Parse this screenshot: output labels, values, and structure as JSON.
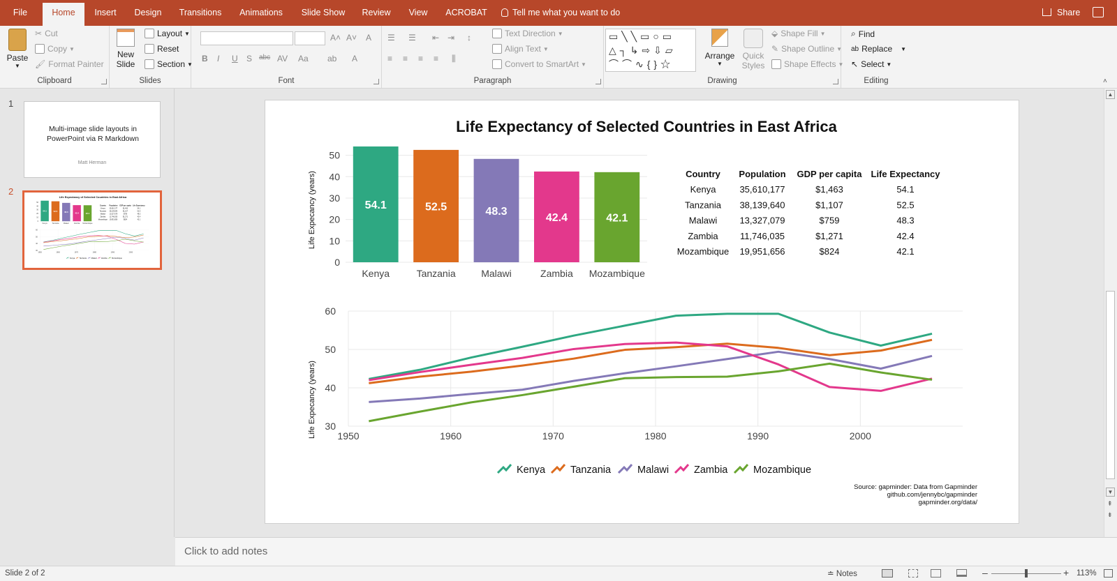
{
  "tabs": [
    {
      "label": "File"
    },
    {
      "label": "Home"
    },
    {
      "label": "Insert"
    },
    {
      "label": "Design"
    },
    {
      "label": "Transitions"
    },
    {
      "label": "Animations"
    },
    {
      "label": "Slide Show"
    },
    {
      "label": "Review"
    },
    {
      "label": "View"
    },
    {
      "label": "ACROBAT"
    }
  ],
  "tell_me": "Tell me what you want to do",
  "share": "Share",
  "ribbon": {
    "clipboard": {
      "label": "Clipboard",
      "paste": "Paste",
      "cut": "Cut",
      "copy": "Copy",
      "format_painter": "Format Painter"
    },
    "slides": {
      "label": "Slides",
      "new_slide_1": "New",
      "new_slide_2": "Slide",
      "layout": "Layout",
      "reset": "Reset",
      "section": "Section"
    },
    "font": {
      "label": "Font"
    },
    "paragraph": {
      "label": "Paragraph",
      "text_direction": "Text Direction",
      "align_text": "Align Text",
      "convert": "Convert to SmartArt"
    },
    "drawing": {
      "label": "Drawing",
      "arrange": "Arrange",
      "quick_styles_1": "Quick",
      "quick_styles_2": "Styles",
      "shape_fill": "Shape Fill",
      "shape_outline": "Shape Outline",
      "shape_effects": "Shape Effects"
    },
    "editing": {
      "label": "Editing",
      "find": "Find",
      "replace": "Replace",
      "select": "Select"
    }
  },
  "thumbnails": [
    {
      "num": "1",
      "title": "Multi-image slide layouts in PowerPoint via R Markdown",
      "author": "Matt Herman"
    },
    {
      "num": "2"
    }
  ],
  "notes_placeholder": "Click to add notes",
  "status": {
    "slide": "Slide 2 of 2",
    "notes": "Notes",
    "zoom": "113%"
  },
  "chart_data": [
    {
      "type": "bar",
      "title": "Life Expectancy of Selected Countries in East Africa",
      "ylabel": "Life Expecancy (years)",
      "categories": [
        "Kenya",
        "Tanzania",
        "Malawi",
        "Zambia",
        "Mozambique"
      ],
      "values": [
        54.1,
        52.5,
        48.3,
        42.4,
        42.1
      ],
      "data_labels": [
        "54.1",
        "52.5",
        "48.3",
        "42.4",
        "42.1"
      ],
      "colors": [
        "#2ea882",
        "#dc6b1d",
        "#8479b7",
        "#e3388c",
        "#69a52f"
      ],
      "ylim": [
        0,
        54.1
      ],
      "yticks": [
        "0",
        "10",
        "20",
        "30",
        "40",
        "50"
      ]
    },
    {
      "type": "table",
      "columns": [
        "Country",
        "Population",
        "GDP per capita",
        "Life Expectancy"
      ],
      "rows": [
        [
          "Kenya",
          "35,610,177",
          "$1,463",
          "54.1"
        ],
        [
          "Tanzania",
          "38,139,640",
          "$1,107",
          "52.5"
        ],
        [
          "Malawi",
          "13,327,079",
          "$759",
          "48.3"
        ],
        [
          "Zambia",
          "11,746,035",
          "$1,271",
          "42.4"
        ],
        [
          "Mozambique",
          "19,951,656",
          "$824",
          "42.1"
        ]
      ]
    },
    {
      "type": "line",
      "ylabel": "Life Expecancy (years)",
      "x": [
        1952,
        1957,
        1962,
        1967,
        1972,
        1977,
        1982,
        1987,
        1992,
        1997,
        2002,
        2007
      ],
      "xlim": [
        1950,
        2010
      ],
      "ylim": [
        30,
        60
      ],
      "xticks": [
        "1950",
        "1960",
        "1970",
        "1980",
        "1990",
        "2000"
      ],
      "yticks": [
        "30",
        "40",
        "50",
        "60"
      ],
      "series": [
        {
          "name": "Kenya",
          "color": "#2ea882",
          "values": [
            42.3,
            44.7,
            47.9,
            50.7,
            53.6,
            56.2,
            58.8,
            59.3,
            59.3,
            54.4,
            51.0,
            54.1
          ]
        },
        {
          "name": "Tanzania",
          "color": "#dc6b1d",
          "values": [
            41.2,
            42.9,
            44.2,
            45.8,
            47.6,
            49.9,
            50.6,
            51.5,
            50.4,
            48.5,
            49.7,
            52.5
          ]
        },
        {
          "name": "Malawi",
          "color": "#8479b7",
          "values": [
            36.3,
            37.2,
            38.4,
            39.5,
            41.8,
            43.8,
            45.6,
            47.5,
            49.4,
            47.5,
            45.0,
            48.3
          ]
        },
        {
          "name": "Zambia",
          "color": "#e3388c",
          "values": [
            42.0,
            44.1,
            46.0,
            47.8,
            50.1,
            51.4,
            51.8,
            50.8,
            46.1,
            40.2,
            39.2,
            42.4
          ]
        },
        {
          "name": "Mozambique",
          "color": "#69a52f",
          "values": [
            31.3,
            33.8,
            36.2,
            38.1,
            40.3,
            42.5,
            42.8,
            42.9,
            44.3,
            46.3,
            44.0,
            42.1
          ]
        }
      ],
      "legend": "bottom",
      "caption": [
        "Source: gapminder: Data from Gapminder",
        "github.com/jennybc/gapminder",
        "gapminder.org/data/"
      ]
    }
  ]
}
